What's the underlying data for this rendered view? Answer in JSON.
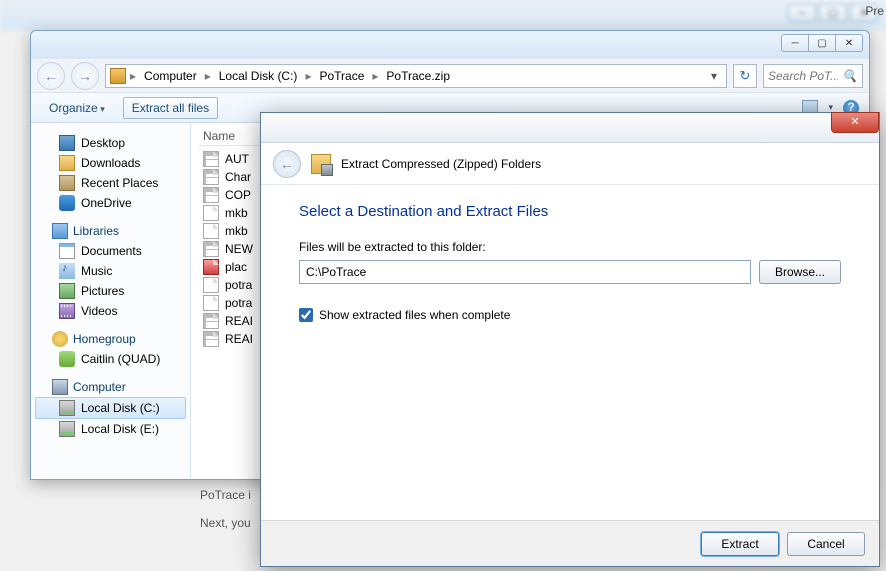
{
  "bg": {
    "pre": "Pre"
  },
  "explorer": {
    "breadcrumbs": [
      "Computer",
      "Local Disk (C:)",
      "PoTrace",
      "PoTrace.zip"
    ],
    "search_placeholder": "Search PoT...",
    "toolbar": {
      "organize": "Organize",
      "extract_all": "Extract all files"
    },
    "sidebar": {
      "favorites": {
        "desktop": "Desktop",
        "downloads": "Downloads",
        "recent": "Recent Places",
        "onedrive": "OneDrive"
      },
      "libraries": {
        "head": "Libraries",
        "documents": "Documents",
        "music": "Music",
        "pictures": "Pictures",
        "videos": "Videos"
      },
      "homegroup": {
        "head": "Homegroup",
        "user": "Caitlin (QUAD)"
      },
      "computer": {
        "head": "Computer",
        "diskc": "Local Disk (C:)",
        "diske": "Local Disk (E:)"
      }
    },
    "filelist": {
      "col_name": "Name",
      "files": [
        "AUT",
        "Char",
        "COP",
        "mkb",
        "mkb",
        "NEW",
        "plac",
        "potra",
        "potra",
        "REAI",
        "REAI"
      ]
    }
  },
  "wizard": {
    "title": "Extract Compressed (Zipped) Folders",
    "heading": "Select a Destination and Extract Files",
    "label": "Files will be extracted to this folder:",
    "path": "C:\\PoTrace",
    "browse": "Browse...",
    "checkbox": "Show extracted files when complete",
    "extract": "Extract",
    "cancel": "Cancel"
  },
  "bg_text": {
    "l1": "PoTrace i",
    "l2": "Next, you"
  }
}
